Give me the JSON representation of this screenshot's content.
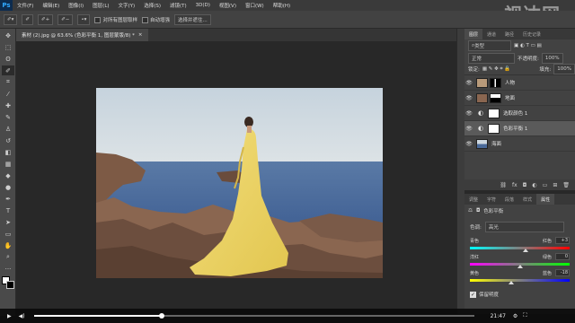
{
  "app": {
    "logo": "Ps"
  },
  "menu": [
    "文件(F)",
    "编辑(E)",
    "图像(I)",
    "图层(L)",
    "文字(Y)",
    "选择(S)",
    "滤镜(T)",
    "3D(D)",
    "视图(V)",
    "窗口(W)",
    "帮助(H)"
  ],
  "options": {
    "sample_all_layers": "对所有图层取样",
    "auto_enhance": "自动增强",
    "select_subject": "选择并遮住..."
  },
  "document": {
    "tab_title": "素材 (2).jpg @ 63.6% (色彩平衡 1, 图层蒙版/8) *",
    "close": "×"
  },
  "layers_panel": {
    "tabs": [
      "图层",
      "通道",
      "路径",
      "历史记录"
    ],
    "filter_label": "类型",
    "blend_mode": "正常",
    "opacity_label": "不透明度:",
    "opacity_value": "100%",
    "lock_label": "锁定:",
    "fill_label": "填充:",
    "fill_value": "100%",
    "layers": [
      {
        "name": "人物",
        "selected": false
      },
      {
        "name": "地面",
        "selected": false
      },
      {
        "name": "选取颜色 1",
        "selected": false
      },
      {
        "name": "色彩平衡 1",
        "selected": true
      },
      {
        "name": "海面",
        "selected": false
      }
    ],
    "footer_icons": "fx"
  },
  "properties_panel": {
    "tabs": [
      "调整",
      "字符",
      "段落",
      "样式",
      "属性"
    ],
    "title": "色彩平衡",
    "tone_label": "色调:",
    "tone_value": "高光",
    "sliders": [
      {
        "left": "青色",
        "right": "红色",
        "value": "+3"
      },
      {
        "left": "洋红",
        "right": "绿色",
        "value": "0"
      },
      {
        "left": "黄色",
        "right": "蓝色",
        "value": "-18"
      }
    ],
    "preserve_luminosity": "保留明度"
  },
  "video": {
    "time": "21:47",
    "progress": 0.29
  },
  "watermark": "视达网",
  "colors": {
    "accent": "#31a8ff",
    "selected_layer": "#5a5a5a"
  }
}
